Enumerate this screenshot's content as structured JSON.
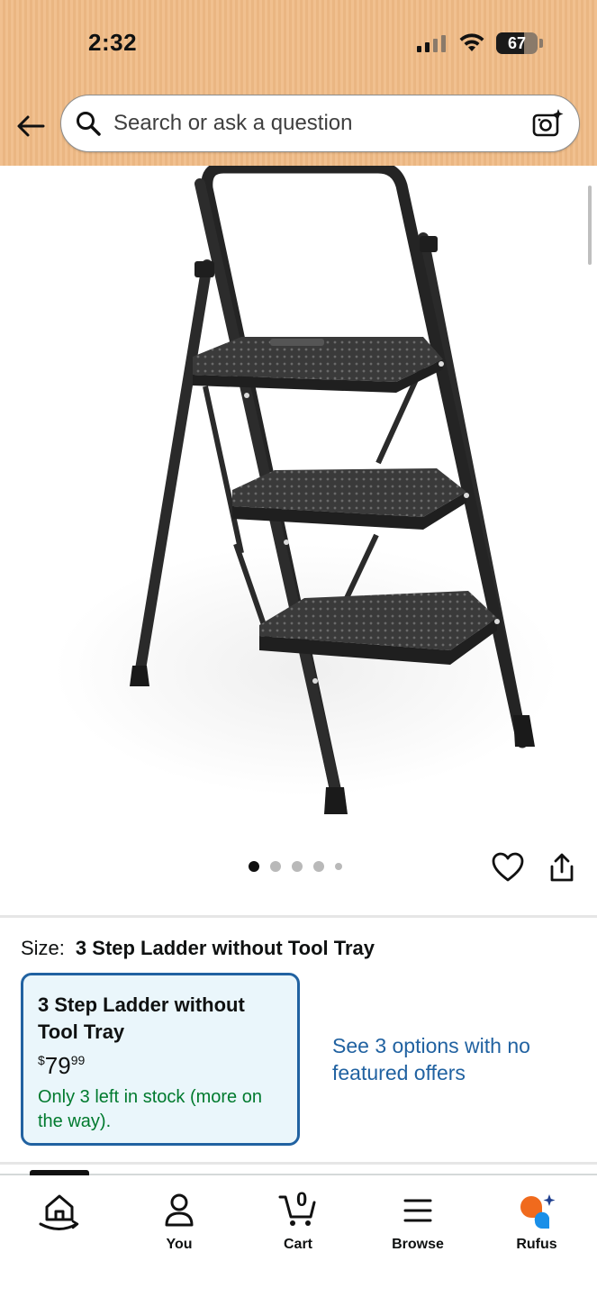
{
  "status_bar": {
    "time": "2:32",
    "battery": "67",
    "battery_level": 0.67
  },
  "search": {
    "placeholder": "Search or ask a question"
  },
  "gallery": {
    "image_count": 5,
    "active_index": 0
  },
  "size": {
    "label": "Size:",
    "value": "3 Step Ladder without Tool Tray"
  },
  "option": {
    "title": "3 Step Ladder without Tool Tray",
    "price_symbol": "$",
    "price_whole": "79",
    "price_cents": "99",
    "stock": "Only 3 left in stock (more on the way)."
  },
  "other_offers": "See 3 options with no featured offers",
  "nav": {
    "home": "",
    "you": "You",
    "cart": "Cart",
    "cart_count": "0",
    "browse": "Browse",
    "rufus": "Rufus"
  },
  "colors": {
    "link": "#2162a1",
    "stock": "#007a2e",
    "header": "#f1c08f",
    "selected_border": "#2162a1"
  }
}
